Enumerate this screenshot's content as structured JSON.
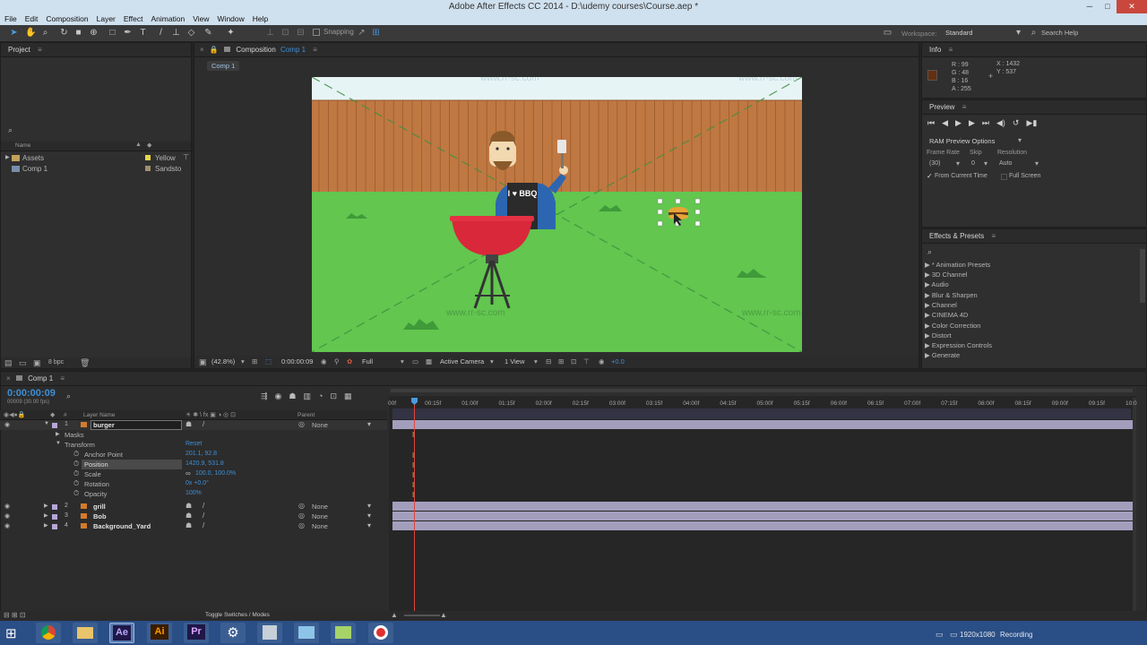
{
  "window": {
    "title": "Adobe After Effects CC 2014 - D:\\udemy courses\\Course.aep *",
    "btn_min": "─",
    "btn_max": "□",
    "btn_close": "✕"
  },
  "menu": [
    "File",
    "Edit",
    "Composition",
    "Layer",
    "Effect",
    "Animation",
    "View",
    "Window",
    "Help"
  ],
  "toolbar": {
    "snapping": "Snapping",
    "workspace_label": "Workspace:",
    "workspace_value": "Standard",
    "search_help": "Search Help"
  },
  "watermark": "www.rr-sc.com",
  "project": {
    "title": "Project",
    "col_name": "Name",
    "items": [
      {
        "name": "Assets",
        "label": "Yellow"
      },
      {
        "name": "Comp 1",
        "label": "Sandsto"
      }
    ],
    "footer_bpc": "8 bpc"
  },
  "composition": {
    "title": "Composition",
    "comp_name": "Comp 1",
    "tab": "Comp 1",
    "zoom": "(42.8%)",
    "timecode": "0:00:00:09",
    "resolution": "Full",
    "camera": "Active Camera",
    "views": "1 View",
    "exposure": "+0.0",
    "apron": "I ♥ BBQ"
  },
  "info": {
    "title": "Info",
    "r": "R : 99",
    "g": "G : 48",
    "b": "B : 16",
    "a": "A : 255",
    "x": "X : 1432",
    "y": "Y : 537",
    "swatch_color": "#633010"
  },
  "preview": {
    "title": "Preview",
    "options": "RAM Preview Options",
    "frame_rate_label": "Frame Rate",
    "skip_label": "Skip",
    "resolution_label": "Resolution",
    "frame_rate": "(30)",
    "skip": "0",
    "resolution": "Auto",
    "from_current": "From Current Time",
    "full_screen": "Full Screen"
  },
  "effects": {
    "title": "Effects & Presets",
    "items": [
      "* Animation Presets",
      "3D Channel",
      "Audio",
      "Blur & Sharpen",
      "Channel",
      "CINEMA 4D",
      "Color Correction",
      "Distort",
      "Expression Controls",
      "Generate"
    ]
  },
  "timeline": {
    "tab": "Comp 1",
    "timecode": "0:00:00:09",
    "frames": "00009 (30.00 fps)",
    "col_num": "#",
    "col_layer": "Layer Name",
    "col_parent": "Parent",
    "layers": [
      {
        "num": "1",
        "name": "burger",
        "parent": "None"
      },
      {
        "num": "2",
        "name": "grill",
        "parent": "None"
      },
      {
        "num": "3",
        "name": "Bob",
        "parent": "None"
      },
      {
        "num": "4",
        "name": "Background_Yard",
        "parent": "None"
      }
    ],
    "masks": "Masks",
    "transform": "Transform",
    "reset": "Reset",
    "props": [
      {
        "name": "Anchor Point",
        "value": "201.1, 92.8"
      },
      {
        "name": "Position",
        "value": "1420.9, 531.8"
      },
      {
        "name": "Scale",
        "value": "100.0, 100.0%"
      },
      {
        "name": "Rotation",
        "value": "0x +0.0°"
      },
      {
        "name": "Opacity",
        "value": "100%"
      }
    ],
    "ruler": [
      "00f",
      "00:15f",
      "01:00f",
      "01:15f",
      "02:00f",
      "02:15f",
      "03:00f",
      "03:15f",
      "04:00f",
      "04:15f",
      "05:00f",
      "05:15f",
      "06:00f",
      "06:15f",
      "07:00f",
      "07:15f",
      "08:00f",
      "08:15f",
      "09:00f",
      "09:15f",
      "10:0"
    ],
    "toggle": "Toggle Switches / Modes"
  },
  "taskbar": {
    "resolution": "1920x1080",
    "recording": "Recording"
  },
  "colors": {
    "accent": "#3f8fd6",
    "layer_bar": "#a49ebd",
    "grass": "#62c64f",
    "fence": "#c07842",
    "sky": "#e7f4f6",
    "grill": "#d9283a"
  }
}
